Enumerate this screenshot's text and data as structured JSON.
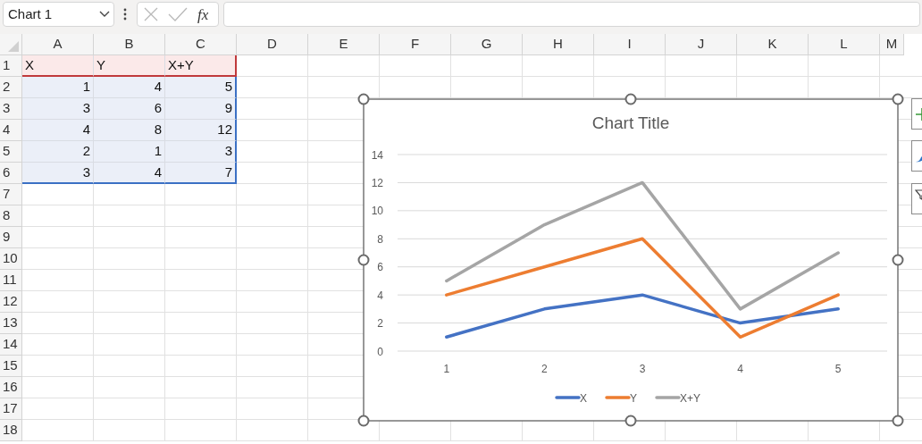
{
  "formula_bar": {
    "name_box": "Chart 1",
    "function_label": "fx",
    "cancel_disabled": true,
    "enter_disabled": true
  },
  "sheet": {
    "columns": [
      "A",
      "B",
      "C",
      "D",
      "E",
      "F",
      "G",
      "H",
      "I",
      "J",
      "K",
      "L",
      "M"
    ],
    "row_numbers": [
      "1",
      "2",
      "3",
      "4",
      "5",
      "6",
      "7",
      "8",
      "9",
      "10",
      "11",
      "12",
      "13",
      "14",
      "15",
      "16",
      "17",
      "18"
    ],
    "rows": [
      {
        "kind": "series_names",
        "cells": [
          "X",
          "Y",
          "X+Y"
        ]
      },
      {
        "kind": "values",
        "cells": [
          "1",
          "4",
          "5"
        ]
      },
      {
        "kind": "values",
        "cells": [
          "3",
          "6",
          "9"
        ]
      },
      {
        "kind": "values",
        "cells": [
          "4",
          "8",
          "12"
        ]
      },
      {
        "kind": "values",
        "cells": [
          "2",
          "1",
          "3"
        ]
      },
      {
        "kind": "values",
        "cells": [
          "3",
          "4",
          "7"
        ]
      }
    ]
  },
  "chart": {
    "selected": true,
    "chart_data": {
      "type": "line",
      "title": "Chart Title",
      "categories": [
        "1",
        "2",
        "3",
        "4",
        "5"
      ],
      "series": [
        {
          "name": "X",
          "color": "#4472c4",
          "values": [
            1,
            3,
            4,
            2,
            3
          ]
        },
        {
          "name": "Y",
          "color": "#ed7d31",
          "values": [
            4,
            6,
            8,
            1,
            4
          ]
        },
        {
          "name": "X+Y",
          "color": "#a5a5a5",
          "values": [
            5,
            9,
            12,
            3,
            7
          ]
        }
      ],
      "ylim": [
        0,
        14
      ],
      "yticks": [
        0,
        2,
        4,
        6,
        8,
        10,
        12,
        14
      ],
      "grid": true,
      "legend": "bottom"
    }
  }
}
